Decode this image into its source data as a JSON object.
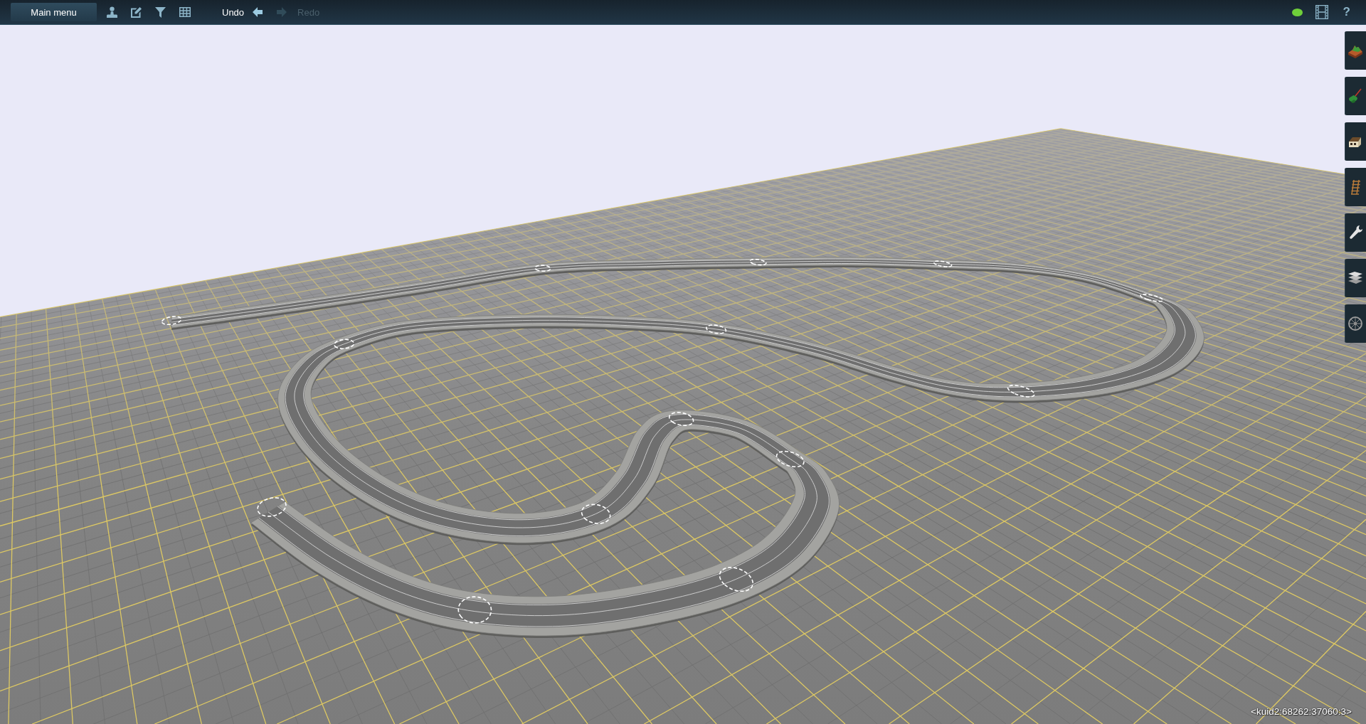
{
  "toolbar": {
    "main_menu": {
      "label": "Main menu"
    },
    "undo": {
      "label": "Undo",
      "disabled": false
    },
    "redo": {
      "label": "Redo",
      "disabled": true
    },
    "help": {
      "label": "?"
    }
  },
  "viewport": {
    "asset_label": "<kuid2:68262:37060:3>"
  }
}
